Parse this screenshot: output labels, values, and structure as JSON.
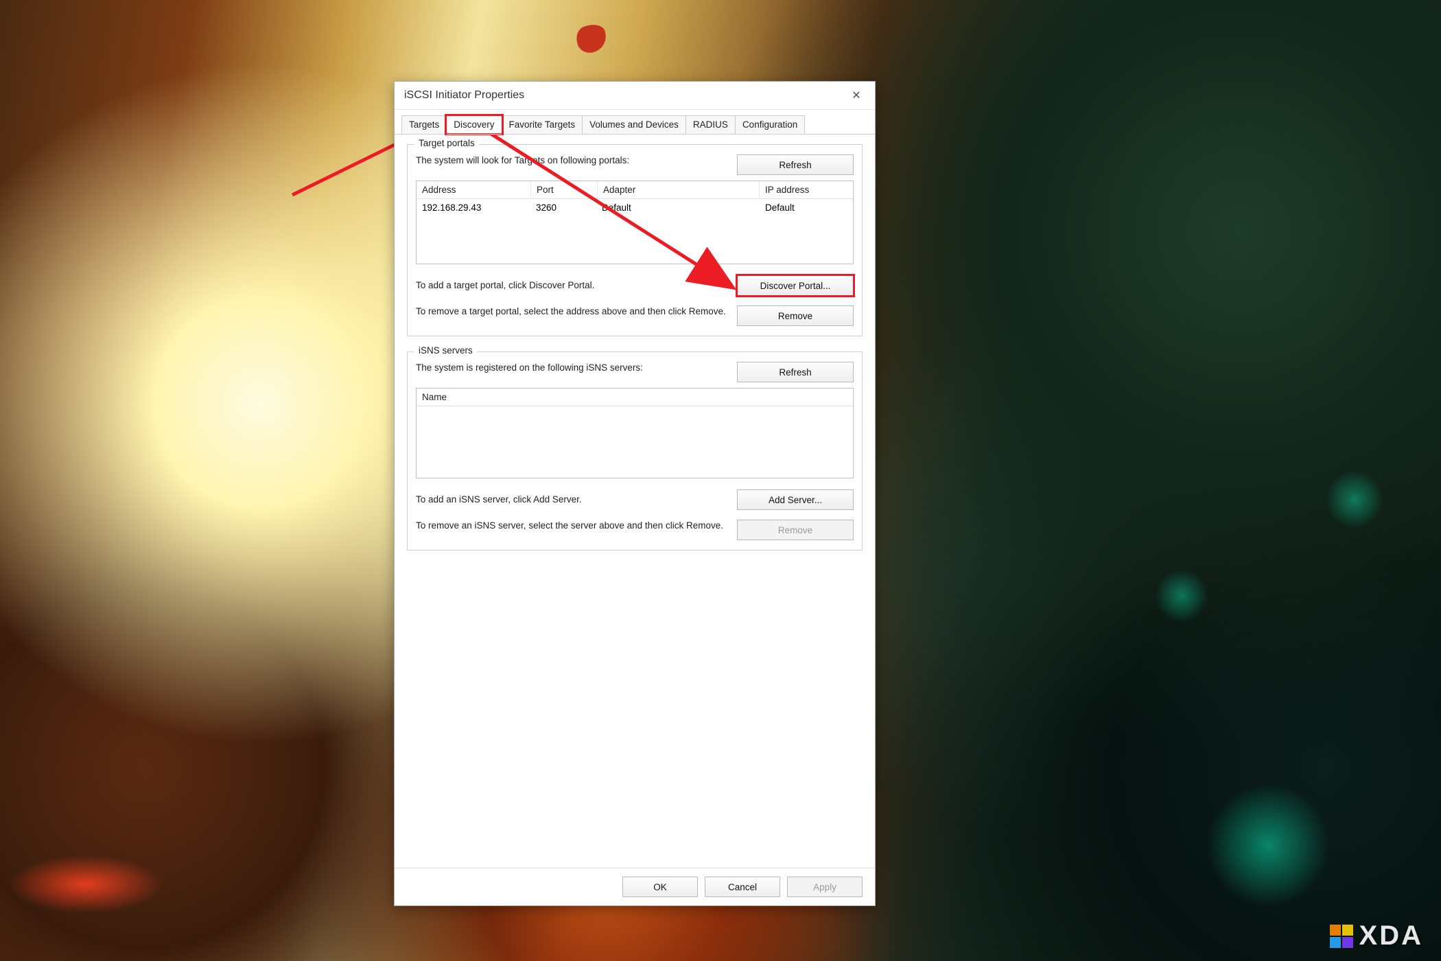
{
  "window": {
    "title": "iSCSI Initiator Properties"
  },
  "tabs": [
    {
      "label": "Targets"
    },
    {
      "label": "Discovery"
    },
    {
      "label": "Favorite Targets"
    },
    {
      "label": "Volumes and Devices"
    },
    {
      "label": "RADIUS"
    },
    {
      "label": "Configuration"
    }
  ],
  "target_portals": {
    "legend": "Target portals",
    "desc": "The system will look for Targets on following portals:",
    "columns": {
      "address": "Address",
      "port": "Port",
      "adapter": "Adapter",
      "ip": "IP address"
    },
    "rows": [
      {
        "address": "192.168.29.43",
        "port": "3260",
        "adapter": "Default",
        "ip": "Default"
      }
    ],
    "add_desc": "To add a target portal, click Discover Portal.",
    "remove_desc": "To remove a target portal, select the address above and then click Remove.",
    "buttons": {
      "refresh": "Refresh",
      "discover": "Discover Portal...",
      "remove": "Remove"
    }
  },
  "isns": {
    "legend": "iSNS servers",
    "desc": "The system is registered on the following iSNS servers:",
    "columns": {
      "name": "Name"
    },
    "add_desc": "To add an iSNS server, click Add Server.",
    "remove_desc": "To remove an iSNS server, select the server above and then click Remove.",
    "buttons": {
      "refresh": "Refresh",
      "add": "Add Server...",
      "remove": "Remove"
    }
  },
  "footer": {
    "ok": "OK",
    "cancel": "Cancel",
    "apply": "Apply"
  },
  "annotations": {
    "highlighted_tab": "Discovery",
    "highlighted_button": "Discover Portal...",
    "colors": {
      "highlight": "#ec1c24"
    }
  },
  "watermark": {
    "text": "XDA"
  }
}
